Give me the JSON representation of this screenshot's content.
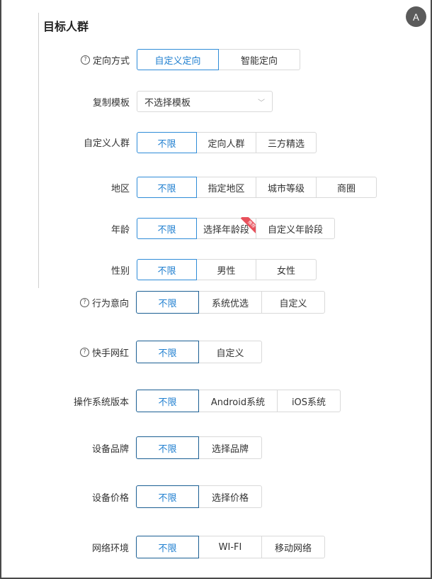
{
  "section": {
    "title": "目标人群"
  },
  "translate_icon": "Ａ",
  "targeting_mode": {
    "label": "定向方式",
    "options": [
      "自定义定向",
      "智能定向"
    ]
  },
  "copy_template": {
    "label": "复制模板",
    "value": "不选择模板"
  },
  "custom_audience": {
    "label": "自定义人群",
    "options": [
      "不限",
      "定向人群",
      "三方精选"
    ]
  },
  "region": {
    "label": "地区",
    "options": [
      "不限",
      "指定地区",
      "城市等级",
      "商圈"
    ]
  },
  "age": {
    "label": "年龄",
    "options": [
      "不限",
      "选择年龄段",
      "自定义年龄段"
    ],
    "badge": "推荐"
  },
  "gender": {
    "label": "性别",
    "options": [
      "不限",
      "男性",
      "女性"
    ]
  },
  "behavior_intent": {
    "label": "行为意向",
    "options": [
      "不限",
      "系统优选",
      "自定义"
    ]
  },
  "kuaishou_influencer": {
    "label": "快手网红",
    "options": [
      "不限",
      "自定义"
    ]
  },
  "os_version": {
    "label": "操作系统版本",
    "options": [
      "不限",
      "Android系统",
      "iOS系统"
    ]
  },
  "device_brand": {
    "label": "设备品牌",
    "options": [
      "不限",
      "选择品牌"
    ]
  },
  "device_price": {
    "label": "设备价格",
    "options": [
      "不限",
      "选择价格"
    ]
  },
  "network": {
    "label": "网络环境",
    "options": [
      "不限",
      "WI-FI",
      "移动网络"
    ]
  },
  "colors": {
    "accent": "#2f8cd8",
    "accent_dark": "#1b5f93",
    "badge": "#e8505b"
  }
}
